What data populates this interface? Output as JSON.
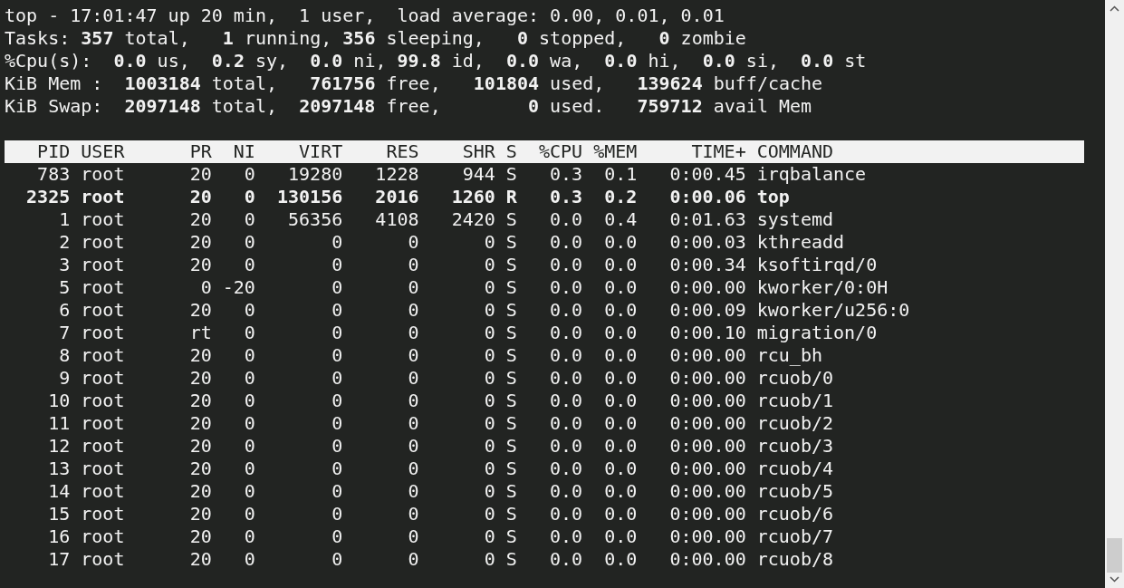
{
  "summary": [
    "top - 17:01:47 up 20 min,  1 user,  load average: 0.00, 0.01, 0.01",
    "Tasks: **357** total,   **1** running, **356** sleeping,   **0** stopped,   **0** zombie",
    "%Cpu(s):  **0.0** us,  **0.2** sy,  **0.0** ni, **99.8** id,  **0.0** wa,  **0.0** hi,  **0.0** si,  **0.0** st",
    "KiB Mem :  **1003184** total,   **761756** free,   **101804** used,   **139624** buff/cache",
    "KiB Swap:  **2097148** total,  **2097148** free,        **0** used.   **759712** avail Mem"
  ],
  "table": {
    "columns": [
      "PID",
      "USER",
      "PR",
      "NI",
      "VIRT",
      "RES",
      "SHR",
      "S",
      "%CPU",
      "%MEM",
      "TIME+",
      "COMMAND"
    ],
    "rows": [
      {
        "cells": [
          "783",
          "root",
          "20",
          "0",
          "19280",
          "1228",
          "944",
          "S",
          "0.3",
          "0.1",
          "0:00.45",
          "irqbalance"
        ],
        "highlighted": false
      },
      {
        "cells": [
          "2325",
          "root",
          "20",
          "0",
          "130156",
          "2016",
          "1260",
          "R",
          "0.3",
          "0.2",
          "0:00.06",
          "top"
        ],
        "highlighted": true
      },
      {
        "cells": [
          "1",
          "root",
          "20",
          "0",
          "56356",
          "4108",
          "2420",
          "S",
          "0.0",
          "0.4",
          "0:01.63",
          "systemd"
        ],
        "highlighted": false
      },
      {
        "cells": [
          "2",
          "root",
          "20",
          "0",
          "0",
          "0",
          "0",
          "S",
          "0.0",
          "0.0",
          "0:00.03",
          "kthreadd"
        ],
        "highlighted": false
      },
      {
        "cells": [
          "3",
          "root",
          "20",
          "0",
          "0",
          "0",
          "0",
          "S",
          "0.0",
          "0.0",
          "0:00.34",
          "ksoftirqd/0"
        ],
        "highlighted": false
      },
      {
        "cells": [
          "5",
          "root",
          "0",
          "-20",
          "0",
          "0",
          "0",
          "S",
          "0.0",
          "0.0",
          "0:00.00",
          "kworker/0:0H"
        ],
        "highlighted": false
      },
      {
        "cells": [
          "6",
          "root",
          "20",
          "0",
          "0",
          "0",
          "0",
          "S",
          "0.0",
          "0.0",
          "0:00.09",
          "kworker/u256:0"
        ],
        "highlighted": false
      },
      {
        "cells": [
          "7",
          "root",
          "rt",
          "0",
          "0",
          "0",
          "0",
          "S",
          "0.0",
          "0.0",
          "0:00.10",
          "migration/0"
        ],
        "highlighted": false
      },
      {
        "cells": [
          "8",
          "root",
          "20",
          "0",
          "0",
          "0",
          "0",
          "S",
          "0.0",
          "0.0",
          "0:00.00",
          "rcu_bh"
        ],
        "highlighted": false
      },
      {
        "cells": [
          "9",
          "root",
          "20",
          "0",
          "0",
          "0",
          "0",
          "S",
          "0.0",
          "0.0",
          "0:00.00",
          "rcuob/0"
        ],
        "highlighted": false
      },
      {
        "cells": [
          "10",
          "root",
          "20",
          "0",
          "0",
          "0",
          "0",
          "S",
          "0.0",
          "0.0",
          "0:00.00",
          "rcuob/1"
        ],
        "highlighted": false
      },
      {
        "cells": [
          "11",
          "root",
          "20",
          "0",
          "0",
          "0",
          "0",
          "S",
          "0.0",
          "0.0",
          "0:00.00",
          "rcuob/2"
        ],
        "highlighted": false
      },
      {
        "cells": [
          "12",
          "root",
          "20",
          "0",
          "0",
          "0",
          "0",
          "S",
          "0.0",
          "0.0",
          "0:00.00",
          "rcuob/3"
        ],
        "highlighted": false
      },
      {
        "cells": [
          "13",
          "root",
          "20",
          "0",
          "0",
          "0",
          "0",
          "S",
          "0.0",
          "0.0",
          "0:00.00",
          "rcuob/4"
        ],
        "highlighted": false
      },
      {
        "cells": [
          "14",
          "root",
          "20",
          "0",
          "0",
          "0",
          "0",
          "S",
          "0.0",
          "0.0",
          "0:00.00",
          "rcuob/5"
        ],
        "highlighted": false
      },
      {
        "cells": [
          "15",
          "root",
          "20",
          "0",
          "0",
          "0",
          "0",
          "S",
          "0.0",
          "0.0",
          "0:00.00",
          "rcuob/6"
        ],
        "highlighted": false
      },
      {
        "cells": [
          "16",
          "root",
          "20",
          "0",
          "0",
          "0",
          "0",
          "S",
          "0.0",
          "0.0",
          "0:00.00",
          "rcuob/7"
        ],
        "highlighted": false
      },
      {
        "cells": [
          "17",
          "root",
          "20",
          "0",
          "0",
          "0",
          "0",
          "S",
          "0.0",
          "0.0",
          "0:00.00",
          "rcuob/8"
        ],
        "highlighted": false
      }
    ]
  }
}
